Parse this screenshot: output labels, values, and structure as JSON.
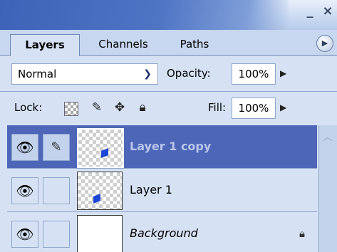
{
  "titlebar": {
    "minimize_label": "_",
    "close_label": "×"
  },
  "tabs": [
    {
      "label": "Layers",
      "active": true
    },
    {
      "label": "Channels",
      "active": false
    },
    {
      "label": "Paths",
      "active": false
    }
  ],
  "panel_menu_icon": "flyout-menu-icon",
  "blend": {
    "mode": "Normal",
    "opacity_label": "Opacity:",
    "opacity_value": "100%"
  },
  "lock": {
    "label": "Lock:",
    "fill_label": "Fill:",
    "fill_value": "100%"
  },
  "layers": [
    {
      "name": "Layer 1 copy",
      "selected": true,
      "visible": true,
      "brush_link": true
    },
    {
      "name": "Layer 1",
      "selected": false,
      "visible": true,
      "brush_link": false
    },
    {
      "name": "Background",
      "selected": false,
      "visible": true,
      "brush_link": false,
      "locked": true
    }
  ],
  "colors": {
    "accent": "#4e66b8",
    "panel": "#d6e2f4",
    "shape": "#1c46d8"
  }
}
